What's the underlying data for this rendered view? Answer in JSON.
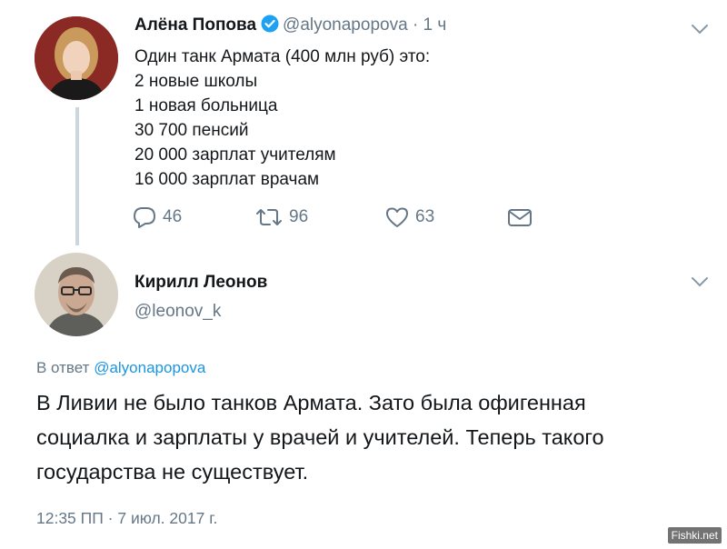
{
  "accent": "#1da1f2",
  "link_color": "#1b95e0",
  "muted_color": "#657786",
  "tweet": {
    "author_name": "Алёна Попова",
    "verified": true,
    "author_handle": "@alyonapopova",
    "time": "· 1 ч",
    "lines": [
      "Один танк Армата (400 млн руб) это:",
      "2 новые школы",
      "1 новая больница",
      "30 700 пенсий",
      "20 000 зарплат учителям",
      "16 000 зарплат врачам"
    ],
    "actions": {
      "reply_count": "46",
      "retweet_count": "96",
      "like_count": "63"
    },
    "icons": [
      "reply-icon",
      "retweet-icon",
      "like-icon",
      "dm-icon",
      "chevron-down-icon",
      "verified-icon"
    ]
  },
  "reply": {
    "author_name": "Кирилл Леонов",
    "author_handle": "@leonov_k",
    "reply_prefix": "В ответ",
    "reply_to": "@alyonapopova",
    "lines": [
      "В Ливии не было танков Армата. Зато была офигенная",
      "социалка и зарплаты у врачей и учителей. Теперь такого",
      "государства не существует."
    ],
    "timestamp": "12:35 ПП · 7 июл. 2017 г."
  },
  "watermark": "Fishki.net"
}
